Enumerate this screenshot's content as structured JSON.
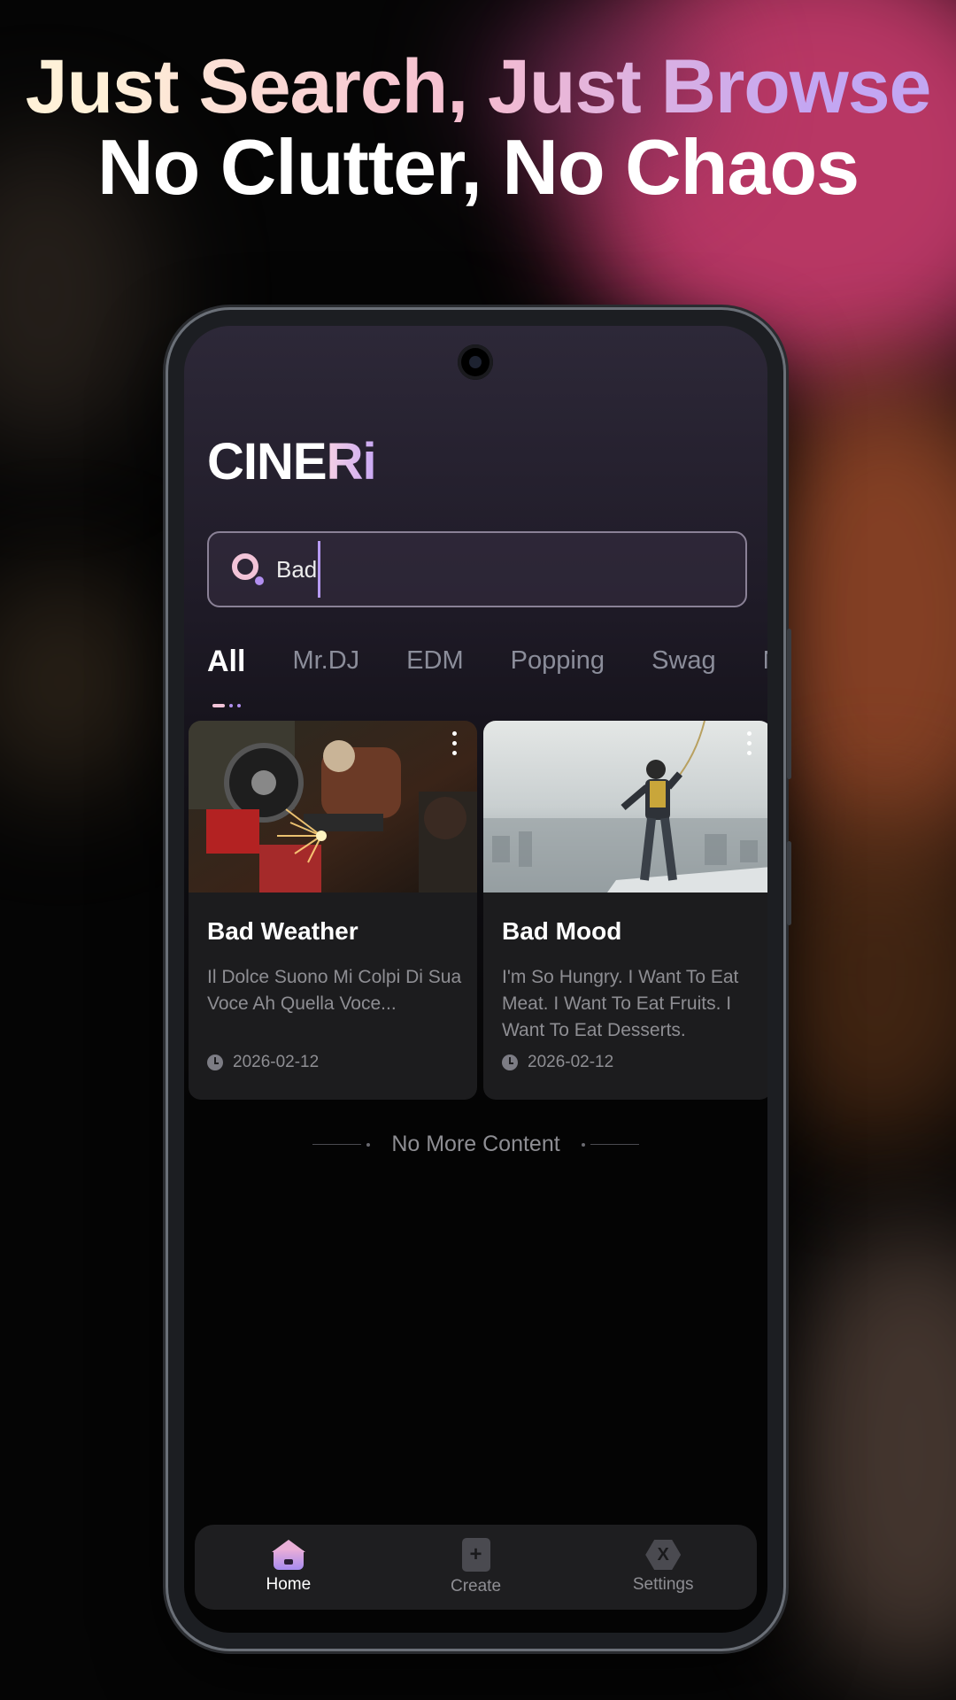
{
  "headline": {
    "line1": "Just Search, Just Browse",
    "line2": "No Clutter, No Chaos"
  },
  "app": {
    "logo_main": "CINE",
    "logo_accent": "Ri"
  },
  "search": {
    "value": "Bad"
  },
  "tabs": [
    {
      "label": "All",
      "active": true
    },
    {
      "label": "Mr.DJ"
    },
    {
      "label": "EDM"
    },
    {
      "label": "Popping"
    },
    {
      "label": "Swag"
    },
    {
      "label": "N"
    }
  ],
  "cards": [
    {
      "title": "Bad Weather",
      "description": "Il Dolce Suono Mi Colpi Di Sua Voce Ah Quella Voce...",
      "date": "2026-02-12",
      "image": "person-welding-motorcycle-photo"
    },
    {
      "title": "Bad Mood",
      "description": "I'm So Hungry. I Want To Eat Meat. I Want To Eat Fruits. I Want To Eat Desserts.",
      "date": "2026-02-12",
      "image": "man-on-rooftop-city-view-photo"
    }
  ],
  "end_of_list": "No More Content",
  "nav": [
    {
      "label": "Home",
      "icon": "home-icon",
      "active": true
    },
    {
      "label": "Create",
      "icon": "create-icon"
    },
    {
      "label": "Settings",
      "icon": "settings-icon"
    }
  ],
  "colors": {
    "accent_pink": "#f2c4d8",
    "accent_purple": "#b28ff0",
    "card_bg": "#1c1c1e",
    "muted_text": "#8e8e93"
  }
}
